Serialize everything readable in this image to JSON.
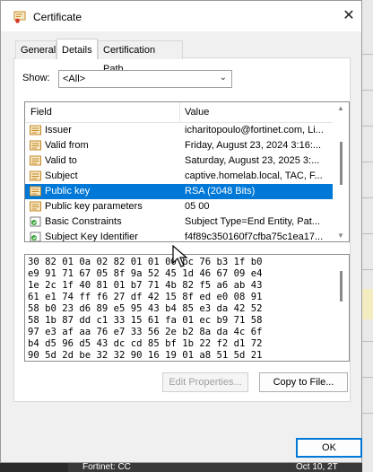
{
  "window": {
    "title": "Certificate",
    "close_glyph": "✕"
  },
  "tabs": [
    {
      "label": "General",
      "active": false
    },
    {
      "label": "Details",
      "active": true
    },
    {
      "label": "Certification Path",
      "active": false
    }
  ],
  "show": {
    "label": "Show:",
    "value": "<All>"
  },
  "fields": {
    "col_field": "Field",
    "col_value": "Value",
    "rows": [
      {
        "name": "Issuer",
        "value": "icharitopoulo@fortinet.com, Li...",
        "icon": "cert-field-icon",
        "selected": false
      },
      {
        "name": "Valid from",
        "value": "Friday, August 23, 2024 3:16:...",
        "icon": "cert-field-icon",
        "selected": false
      },
      {
        "name": "Valid to",
        "value": "Saturday, August 23, 2025 3:...",
        "icon": "cert-field-icon",
        "selected": false
      },
      {
        "name": "Subject",
        "value": "captive.homelab.local, TAC, F...",
        "icon": "cert-field-icon",
        "selected": false
      },
      {
        "name": "Public key",
        "value": "RSA (2048 Bits)",
        "icon": "cert-field-icon",
        "selected": true
      },
      {
        "name": "Public key parameters",
        "value": "05 00",
        "icon": "cert-field-icon",
        "selected": false
      },
      {
        "name": "Basic Constraints",
        "value": "Subject Type=End Entity, Pat...",
        "icon": "extension-icon",
        "selected": false
      },
      {
        "name": "Subject Key Identifier",
        "value": "f4f89c350160f7cfba75c1ea17...",
        "icon": "extension-icon",
        "selected": false
      }
    ]
  },
  "hex_lines": [
    "30 82 01 0a 02 82 01 01 00 bc 76 b3 1f b0",
    "e9 91 71 67 05 8f 9a 52 45 1d 46 67 09 e4",
    "1e 2c 1f 40 81 01 b7 71 4b 82 f5 a6 ab 43",
    "61 e1 74 ff f6 27 df 42 15 8f ed e0 08 91",
    "58 b0 23 d6 89 e5 95 43 b4 85 e3 da 42 52",
    "58 1b 87 dd c1 33 15 61 fa 01 ec b9 71 58",
    "97 e3 af aa 76 e7 33 56 2e b2 8a da 4c 6f",
    "b4 d5 96 d5 43 dc cd 85 bf 1b 22 f2 d1 72",
    "90 5d 2d be 32 32 90 16 19 01 a8 51 5d 21"
  ],
  "buttons": {
    "edit_properties": "Edit Properties...",
    "copy_to_file": "Copy to File...",
    "ok": "OK"
  },
  "background": {
    "bottom_text": "Fortinet: CC",
    "bottom_right_text": "Oct 10, 2T",
    "left_char": "s"
  },
  "colors": {
    "selection": "#0078d7",
    "window_bg": "#f0f0f0"
  }
}
